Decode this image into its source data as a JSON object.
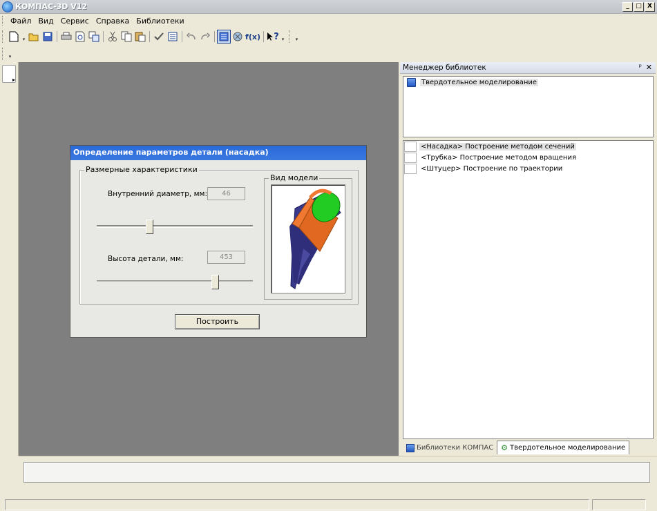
{
  "app": {
    "title": "КОМПАС-3D V12"
  },
  "window_controls": {
    "minimize": "_",
    "maximize": "□",
    "close": "X"
  },
  "menu": {
    "items": [
      "Файл",
      "Вид",
      "Сервис",
      "Справка",
      "Библиотеки"
    ]
  },
  "toolbar": {
    "icons": [
      "new-file-icon",
      "dropdown-arrow-icon",
      "open-icon",
      "save-icon",
      "print-icon",
      "print-preview-icon",
      "copy-props-icon",
      "cut-icon",
      "copy-icon",
      "paste-icon",
      "check-icon",
      "list-icon",
      "undo-icon",
      "redo-icon",
      "library-manager-icon",
      "variables-icon",
      "fx-icon",
      "help-cursor-icon"
    ],
    "fx_label": "f(x)",
    "help_label": "?"
  },
  "dialog": {
    "title": "Определение параметров детали (насадка)",
    "group_label": "Размерные характеристики",
    "inner_diameter_label": "Внутренний диаметр, мм:",
    "inner_diameter_value": "46",
    "inner_diameter_slider": 0.33,
    "height_label": "Высота детали, мм:",
    "height_value": "453",
    "height_slider": 0.77,
    "preview_label": "Вид модели",
    "build_button": "Построить"
  },
  "library_manager": {
    "title": "Менеджер библиотек",
    "pin": "ᵖ",
    "close": "✕",
    "top_items": [
      {
        "label": "Твердотельное моделирование"
      }
    ],
    "items": [
      {
        "label": "<Насадка> Построение методом сечений",
        "selected": true
      },
      {
        "label": "<Трубка> Построение методом вращения",
        "selected": false
      },
      {
        "label": "<Штуцер> Построение по траектории",
        "selected": false
      }
    ],
    "tabs": [
      {
        "label": "Библиотеки КОМПАС",
        "active": false
      },
      {
        "label": "Твердотельное моделирование",
        "active": true
      }
    ]
  },
  "colors": {
    "titlebar": "#c0c4c8",
    "dialog_title": "#2a6ad8",
    "workspace": "#7f7f7f",
    "model_green": "#22cc22",
    "model_orange": "#f07830",
    "model_blue": "#3a3a8c"
  }
}
